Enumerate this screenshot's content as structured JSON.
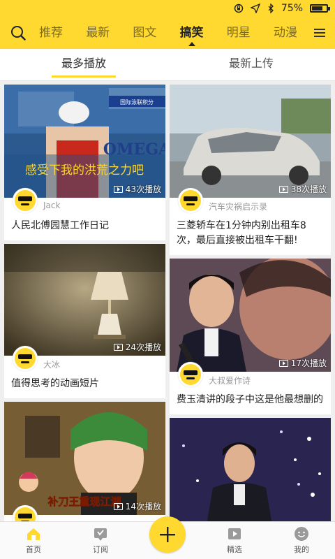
{
  "status": {
    "battery": "75%",
    "battery_level": 0.75
  },
  "nav": {
    "tabs": [
      "推荐",
      "最新",
      "图文",
      "搞笑",
      "明星",
      "动漫"
    ],
    "active_tab": "搞笑"
  },
  "sort": {
    "tabs": [
      "最多播放",
      "最新上传"
    ],
    "active": "最多播放"
  },
  "feed": {
    "left": [
      {
        "plays": "43次播放",
        "author": "Jack",
        "title": "人民北傅园慧工作日记",
        "overlay_text": "感受下我的洪荒之力吧",
        "banner_text": "国际泳联积分",
        "logo_text": "OMEGA"
      },
      {
        "plays": "24次播放",
        "author": "大冰",
        "title": "值得思考的动画短片"
      },
      {
        "plays": "14次播放",
        "overlay_text": "补刀王重现江湖"
      }
    ],
    "right": [
      {
        "plays": "38次播放",
        "author": "汽车灾祸启示录",
        "title": "三菱轿车在1分钟内别出租车8次，最后直接被出租车干翻!"
      },
      {
        "plays": "17次播放",
        "author": "大叔爱作诗",
        "title": "费玉清讲的段子中这是他最想删的"
      },
      {}
    ]
  },
  "bottom_nav": {
    "items": [
      "首页",
      "订阅",
      "精选",
      "我的"
    ],
    "active": "首页"
  },
  "colors": {
    "accent": "#ffd92f"
  }
}
